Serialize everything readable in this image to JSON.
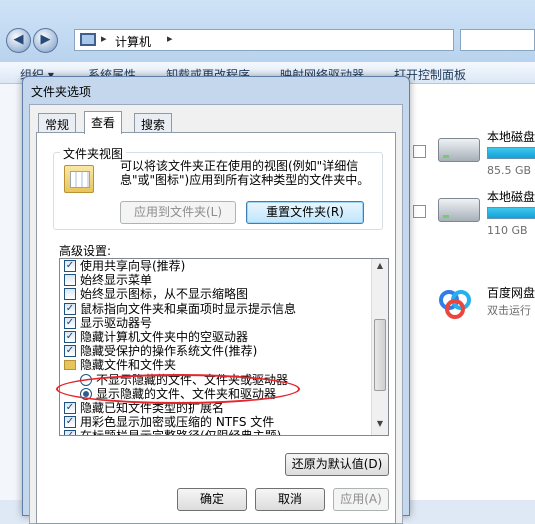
{
  "explorer": {
    "address_path": "计算机",
    "address_sep": "▸",
    "toolbar": [
      "组织 ▾",
      "系统属性",
      "卸载或更改程序",
      "映射网络驱动器",
      "打开控制面板"
    ],
    "drives": [
      {
        "name": "本地磁盘",
        "size": "85.5 GB"
      },
      {
        "name": "本地磁盘",
        "size": "110 GB"
      }
    ],
    "baidu": {
      "name": "百度网盘",
      "sub": "双击运行"
    }
  },
  "dialog": {
    "title": "文件夹选项",
    "tabs": [
      "常规",
      "查看",
      "搜索"
    ],
    "active_tab": "查看",
    "folder_views": {
      "legend": "文件夹视图",
      "description": "可以将该文件夹正在使用的视图(例如\"详细信息\"或\"图标\")应用到所有这种类型的文件夹中。",
      "apply_button": "应用到文件夹(L)",
      "reset_button": "重置文件夹(R)"
    },
    "advanced_label": "高级设置:",
    "advanced_items": [
      {
        "type": "checkbox",
        "checked": true,
        "label": "使用共享向导(推荐)"
      },
      {
        "type": "checkbox",
        "checked": false,
        "label": "始终显示菜单"
      },
      {
        "type": "checkbox",
        "checked": false,
        "label": "始终显示图标，从不显示缩略图"
      },
      {
        "type": "checkbox",
        "checked": true,
        "label": "鼠标指向文件夹和桌面项时显示提示信息"
      },
      {
        "type": "checkbox",
        "checked": true,
        "label": "显示驱动器号"
      },
      {
        "type": "checkbox",
        "checked": true,
        "label": "隐藏计算机文件夹中的空驱动器"
      },
      {
        "type": "checkbox",
        "checked": true,
        "label": "隐藏受保护的操作系统文件(推荐)"
      },
      {
        "type": "folder",
        "label": "隐藏文件和文件夹"
      },
      {
        "type": "radio",
        "checked": false,
        "label": "不显示隐藏的文件、文件夹或驱动器"
      },
      {
        "type": "radio",
        "checked": true,
        "label": "显示隐藏的文件、文件夹和驱动器"
      },
      {
        "type": "checkbox",
        "checked": true,
        "label": "隐藏已知文件类型的扩展名"
      },
      {
        "type": "checkbox",
        "checked": true,
        "label": "用彩色显示加密或压缩的 NTFS 文件"
      },
      {
        "type": "checkbox",
        "checked": true,
        "label": "在标题栏显示完整路径(仅限经典主题)"
      }
    ],
    "restore_button": "还原为默认值(D)",
    "ok_button": "确定",
    "cancel_button": "取消",
    "apply_button": "应用(A)"
  },
  "colors": {
    "highlight": "#e4262c",
    "dialog_frame": "#c4d7ed"
  }
}
